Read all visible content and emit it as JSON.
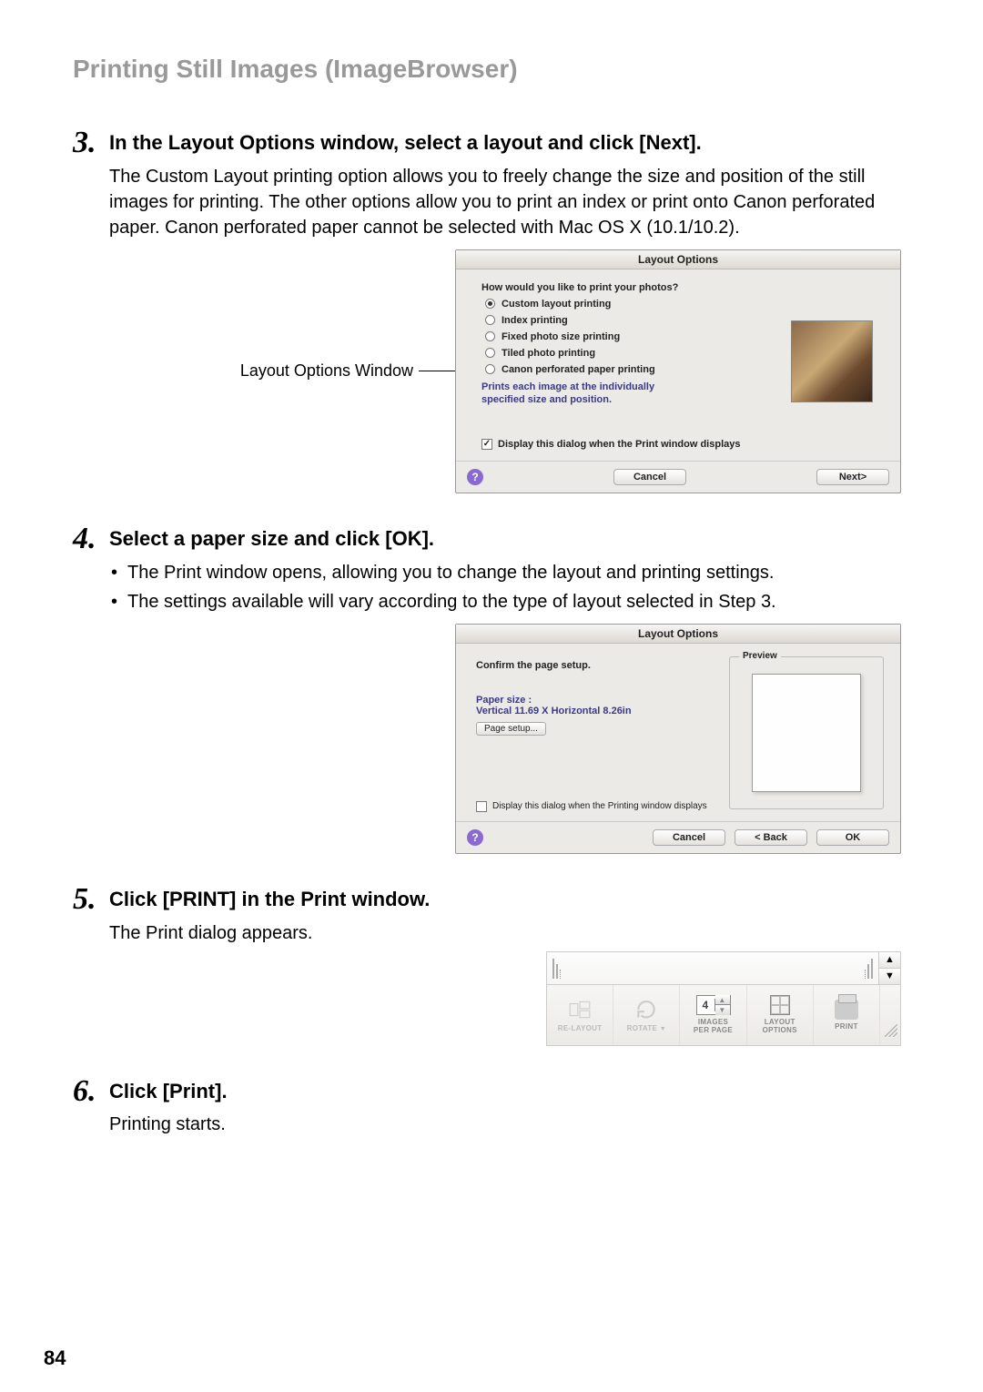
{
  "section_title": "Printing Still Images (ImageBrowser)",
  "page_number": "84",
  "step3": {
    "num": "3.",
    "title": "In the Layout Options window, select a layout and click [Next].",
    "body": "The Custom Layout printing option allows you to freely change the size and position of the still images for printing. The other options allow you to print an index or print onto Canon perforated paper. Canon perforated paper cannot be selected with Mac OS X (10.1/10.2).",
    "figure_label": "Layout Options Window"
  },
  "step4": {
    "num": "4.",
    "title": "Select a paper size and click [OK].",
    "bullet1": "The Print window opens, allowing you to change the layout and printing settings.",
    "bullet2": "The settings available will vary according to the type of layout selected in Step 3."
  },
  "step5": {
    "num": "5.",
    "title": "Click [PRINT] in the Print window.",
    "body": "The Print dialog appears."
  },
  "step6": {
    "num": "6.",
    "title": "Click [Print].",
    "body": "Printing starts."
  },
  "dlg1": {
    "title": "Layout Options",
    "question": "How would you like to print your photos?",
    "opts": {
      "custom": "Custom layout printing",
      "index": "Index printing",
      "fixed": "Fixed photo size printing",
      "tiled": "Tiled photo printing",
      "perf": "Canon perforated paper printing"
    },
    "desc": "Prints each image at the individually specified size and position.",
    "check_label": "Display this dialog when the Print window displays",
    "cancel": "Cancel",
    "next": "Next>"
  },
  "dlg2": {
    "title": "Layout Options",
    "confirm": "Confirm the page setup.",
    "paper_label": "Paper size :",
    "paper_value": "Vertical 11.69 X Horizontal 8.26in",
    "setup_btn": "Page setup...",
    "preview_label": "Preview",
    "check_label": "Display this dialog when the Printing window displays",
    "cancel": "Cancel",
    "back": "< Back",
    "ok": "OK"
  },
  "toolbar": {
    "relayout": "RE-LAYOUT",
    "rotate": "ROTATE",
    "images_top": "IMAGES",
    "images_bot": "PER PAGE",
    "images_val": "4",
    "layout_top": "LAYOUT",
    "layout_bot": "OPTIONS",
    "print": "PRINT"
  }
}
